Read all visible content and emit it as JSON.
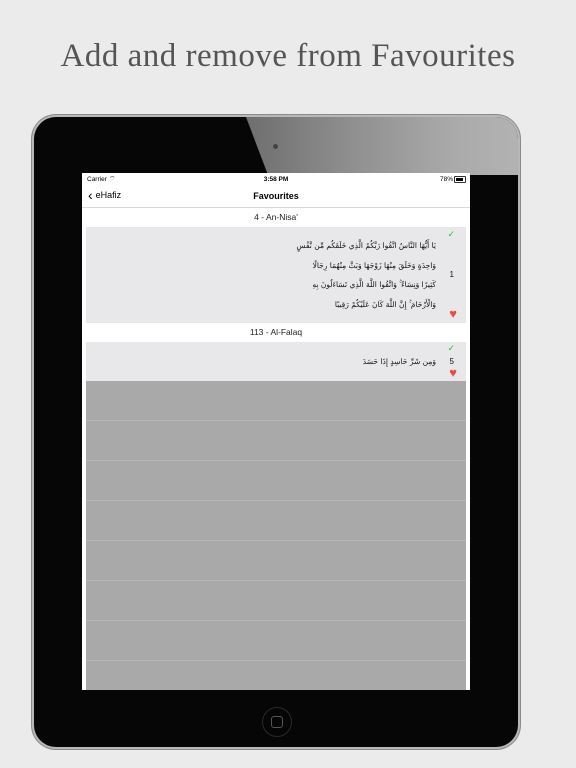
{
  "headline": "Add and remove from Favourites",
  "statusbar": {
    "carrier": "Carrier",
    "time": "3:58 PM",
    "battery": "78%"
  },
  "navbar": {
    "back_label": "eHafiz",
    "title": "Favourites"
  },
  "sections": [
    {
      "header": "4 - An-Nisa'",
      "verses": [
        {
          "number": "1",
          "arabic": "يَا أَيُّهَا النَّاسُ اتَّقُوا رَبَّكُمُ الَّذِي خَلَقَكُم مِّن نَّفْسٍ وَاحِدَةٍ وَخَلَقَ مِنْهَا زَوْجَهَا وَبَثَّ مِنْهُمَا رِجَالًا كَثِيرًا وَنِسَاءً ۚ وَاتَّقُوا اللَّهَ الَّذِي تَسَاءَلُونَ بِهِ وَالْأَرْحَامَ ۚ إِنَّ اللَّهَ كَانَ عَلَيْكُمْ رَقِيبًا"
        }
      ]
    },
    {
      "header": "113 - Al-Falaq",
      "verses": [
        {
          "number": "5",
          "arabic": "وَمِن شَرِّ حَاسِدٍ إِذَا حَسَدَ"
        }
      ]
    }
  ],
  "colors": {
    "check": "#2fc12f",
    "heart": "#ea4b43",
    "row_bg": "#e8e8ea",
    "empty_bg": "#a9a9a9"
  },
  "icons": {
    "back": "chevron-left-icon",
    "memorized": "check-icon",
    "favourite": "heart-icon"
  }
}
